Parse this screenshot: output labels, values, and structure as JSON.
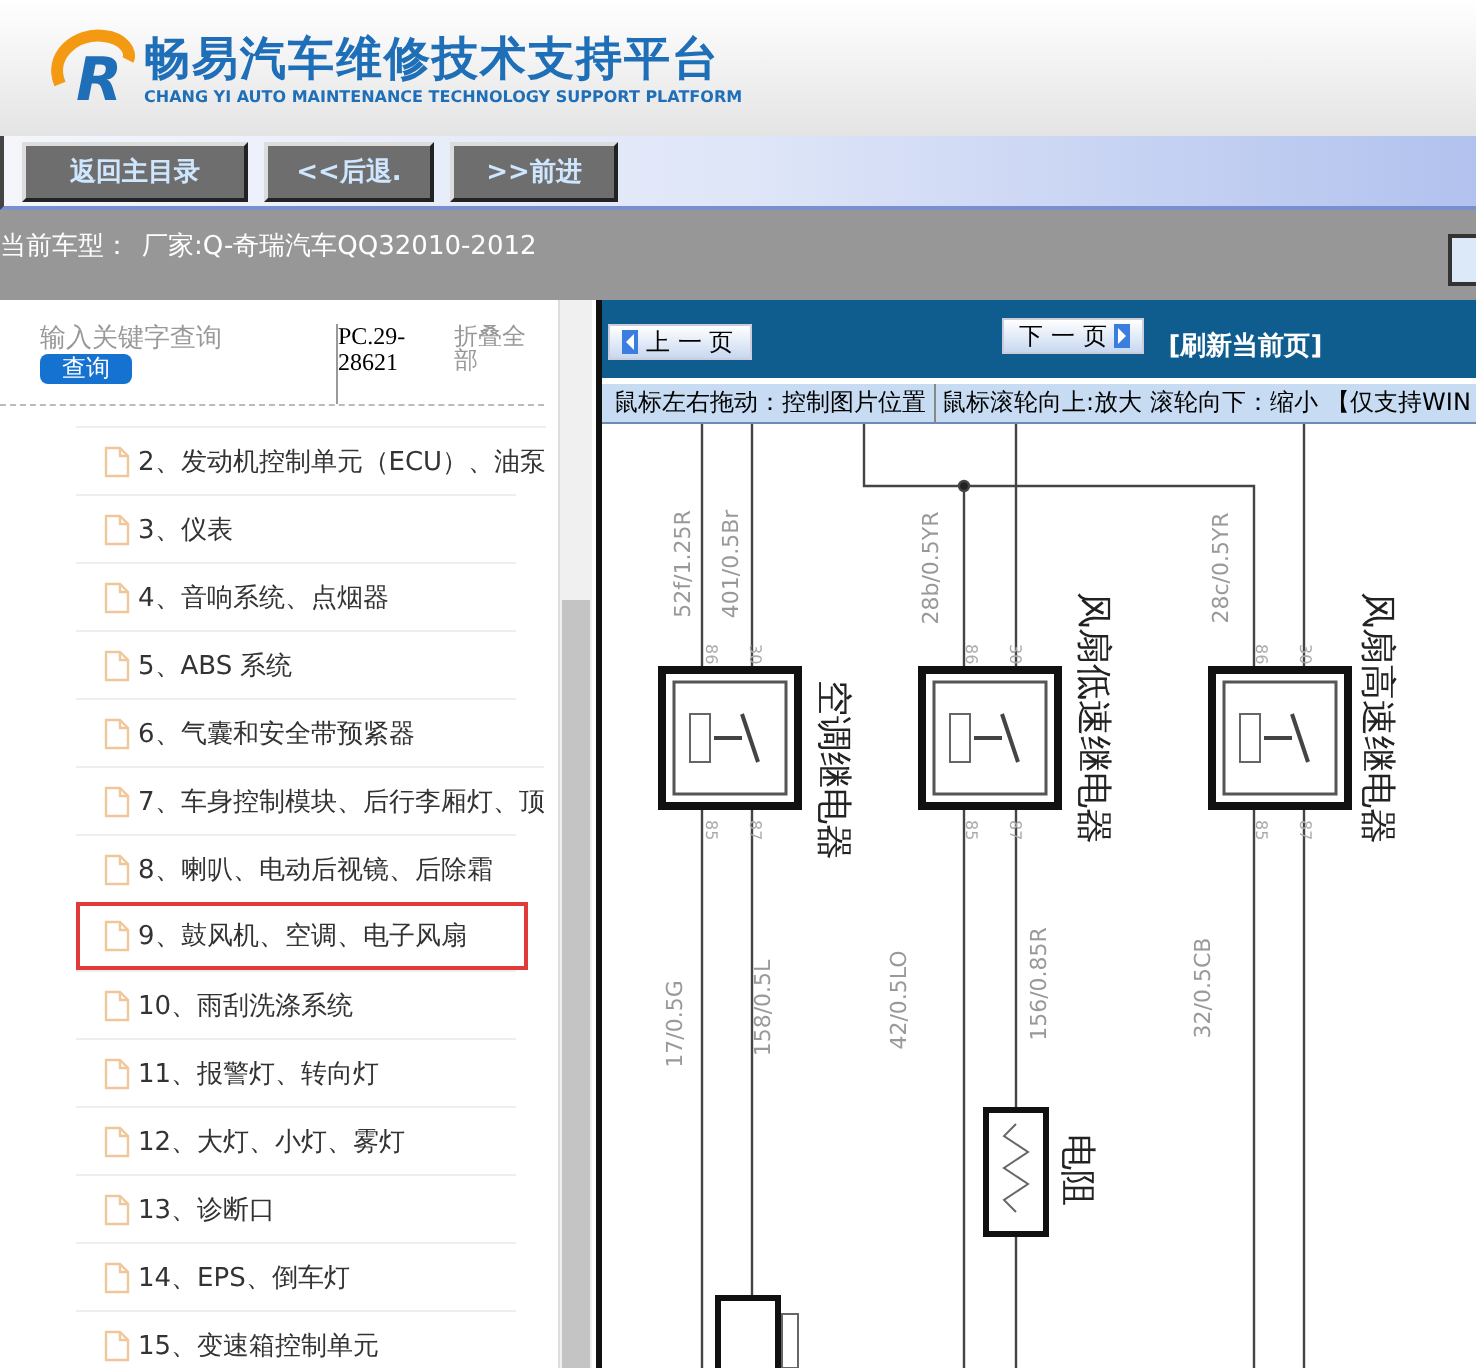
{
  "header": {
    "logo_letter": "R",
    "title": "畅易汽车维修技术支持平台",
    "subtitle": "CHANG YI AUTO MAINTENANCE TECHNOLOGY SUPPORT PLATFORM"
  },
  "toolbar": {
    "buttons": [
      "返回主目录",
      "<<后退.",
      ">>前进"
    ]
  },
  "vehicle_bar": {
    "label": "当前车型：",
    "value": "厂家:Q-奇瑞汽车QQ32010-2012"
  },
  "sidebar": {
    "search": {
      "placeholder": "输入关键字查询",
      "button": "查询"
    },
    "code": "PC.29-28621",
    "collapse": "折叠全部",
    "items": [
      {
        "label": "2、发动机控制单元（ECU）、油泵",
        "selected": false
      },
      {
        "label": "3、仪表",
        "selected": false
      },
      {
        "label": "4、音响系统、点烟器",
        "selected": false
      },
      {
        "label": "5、ABS 系统",
        "selected": false
      },
      {
        "label": "6、气囊和安全带预紧器",
        "selected": false
      },
      {
        "label": "7、车身控制模块、后行李厢灯、顶",
        "selected": false
      },
      {
        "label": "8、喇叭、电动后视镜、后除霜",
        "selected": false
      },
      {
        "label": "9、鼓风机、空调、电子风扇",
        "selected": true
      },
      {
        "label": "10、雨刮洗涤系统",
        "selected": false
      },
      {
        "label": "11、报警灯、转向灯",
        "selected": false
      },
      {
        "label": "12、大灯、小灯、雾灯",
        "selected": false
      },
      {
        "label": "13、诊断口",
        "selected": false
      },
      {
        "label": "14、EPS、倒车灯",
        "selected": false
      },
      {
        "label": "15、变速箱控制单元",
        "selected": false
      }
    ]
  },
  "viewer": {
    "prev": "上 一 页",
    "next": "下 一 页",
    "refresh": "[刷新当前页]",
    "hints": [
      "鼠标左右拖动：控制图片位置",
      "鼠标滚轮向上:放大",
      "滚轮向下：缩小",
      "【仅支持WIN"
    ],
    "diagram": {
      "relays": [
        {
          "name": "空调继电器",
          "pins": [
            "86",
            "30",
            "85",
            "87"
          ]
        },
        {
          "name": "风扇低速继电器",
          "pins": [
            "86",
            "30",
            "85",
            "87"
          ]
        },
        {
          "name": "风扇高速继电器",
          "pins": [
            "86",
            "30",
            "85",
            "87"
          ]
        }
      ],
      "wire_labels": [
        "52f/1.25R",
        "401/0.5Br",
        "28b/0.5YR",
        "28c/0.5YR",
        "17/0.5G",
        "158/0.5L",
        "42/0.5LO",
        "156/0.85R",
        "32/0.5CB"
      ],
      "resistor": "电阻"
    }
  }
}
